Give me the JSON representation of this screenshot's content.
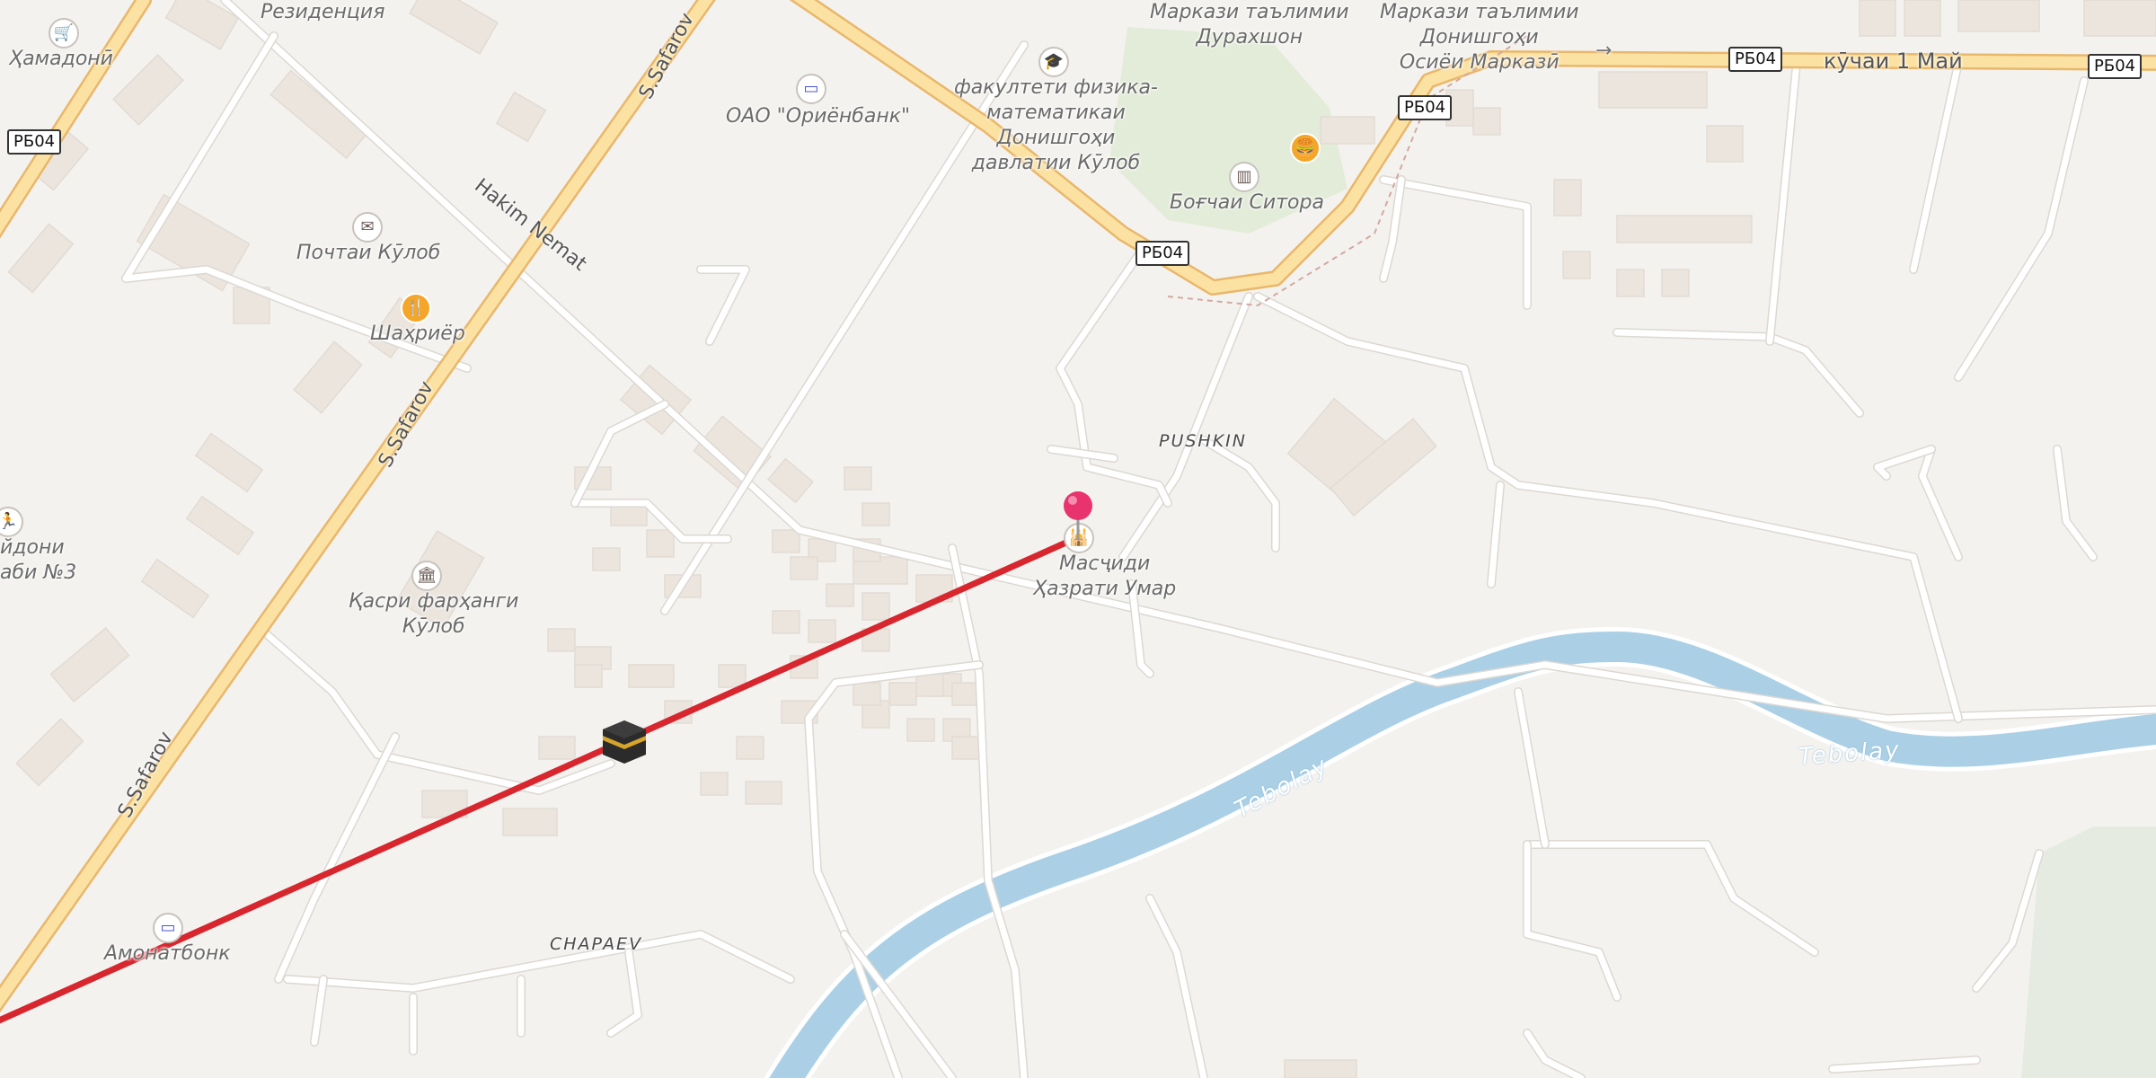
{
  "map": {
    "colors": {
      "background": "#f4f2ef",
      "major_road": "#fbe2a3",
      "minor_road": "#ffffff",
      "river": "#abd0e6",
      "route_line": "#d7262e",
      "pin": "#e8336f",
      "park": "#e3ecd9"
    },
    "route_shields": [
      {
        "id": "rb04-a",
        "text": "РБ04"
      },
      {
        "id": "rb04-b",
        "text": "РБ04"
      },
      {
        "id": "rb04-c",
        "text": "РБ04"
      },
      {
        "id": "rb04-d",
        "text": "РБ04"
      },
      {
        "id": "rb04-e",
        "text": "РБ04"
      }
    ],
    "street_labels": {
      "safarov_top": "S.Safarov",
      "safarov_mid": "S.Safarov",
      "safarov_bottom": "S.Safarov",
      "hakim_nemat": "Hakim Nemat",
      "pushkin": "PUSHKIN",
      "chapaev": "CHAPAEV",
      "first_may": "кӯчаи 1 Май"
    },
    "river_labels": {
      "tebolay_1": "Tebolay",
      "tebolay_2": "Tebolay"
    },
    "places": {
      "residence": "Резиденция",
      "hamadoni": "Ҳамадонӣ",
      "orienbank": "ОАО \"Ориёнбанк\"",
      "post": "Почтаи Кӯлоб",
      "shahriyor": "Шаҳриёр",
      "physics_faculty": "факултети физика-\nматематикаи\nДонишгоҳи\nдавлатии Кӯлоб",
      "edu_center_durakhshon": "Маркази таълимии\nДурахшон",
      "edu_center_university": "Маркази таълимии\nДонишгоҳи\nОсиёи Марказӣ",
      "bogchai_sitora": "Боғчаи Ситора",
      "stadium": "йдони\nаби №3",
      "culture_palace": "Қасри фарҳанги\nКӯлоб",
      "mosque": "Масҷиди\nҲазрати Умар",
      "amonatbank": "Амонатбонк"
    },
    "icons": {
      "shop": "shopping-basket-icon",
      "bank": "bank-icon",
      "post": "mail-icon",
      "restaurant": "restaurant-icon",
      "university": "graduation-cap-icon",
      "kindergarten": "kindergarten-icon",
      "fastfood": "burger-icon",
      "sport": "running-icon",
      "museum": "museum-icon",
      "mosque": "mosque-icon",
      "qibla": "kaaba-icon",
      "pin": "location-pin-icon"
    },
    "arrow": "→"
  }
}
